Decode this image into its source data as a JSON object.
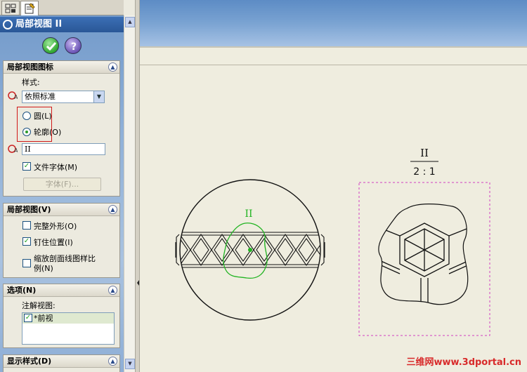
{
  "property_manager": {
    "title": "局部视图 II",
    "sections": {
      "detail_circle": {
        "header": "局部视图图标",
        "style_label": "样式:",
        "style_value": "依照标准",
        "radio_circle": "圆(L)",
        "radio_profile": "轮廓(O)",
        "selected_radio": "轮廓(O)",
        "label_value": "II",
        "doc_font_checkbox": "文件字体(M)",
        "doc_font_checked": true,
        "font_button": "字体(F)..."
      },
      "detail_view": {
        "header": "局部视图(V)",
        "full_outline": "完整外形(O)",
        "full_outline_checked": false,
        "pin_position": "钉住位置(I)",
        "pin_position_checked": true,
        "scale_hatch_line1": "缩放剖面线图样比",
        "scale_hatch_line2": "例(N)",
        "scale_hatch_checked": false
      },
      "options": {
        "header": "选项(N)",
        "annotation_views_label": "注解视图:",
        "annotation_item": "*前视",
        "annotation_item_checked": true
      },
      "display_style": {
        "header": "显示样式(D)"
      }
    }
  },
  "drawing": {
    "circle_label": "II",
    "detail_label": "II",
    "detail_scale": "2 : 1"
  },
  "watermark": {
    "brand": "三维网",
    "site": "www.3dportal.cn"
  },
  "colors": {
    "title_bar": "#2a5797",
    "ok_button": "#2fa52f",
    "help_button": "#6b54b5",
    "profile_sketch": "#22b422",
    "detail_border": "#d040c0",
    "watermark": "#d82a2a",
    "highlight_box": "#d01818"
  }
}
